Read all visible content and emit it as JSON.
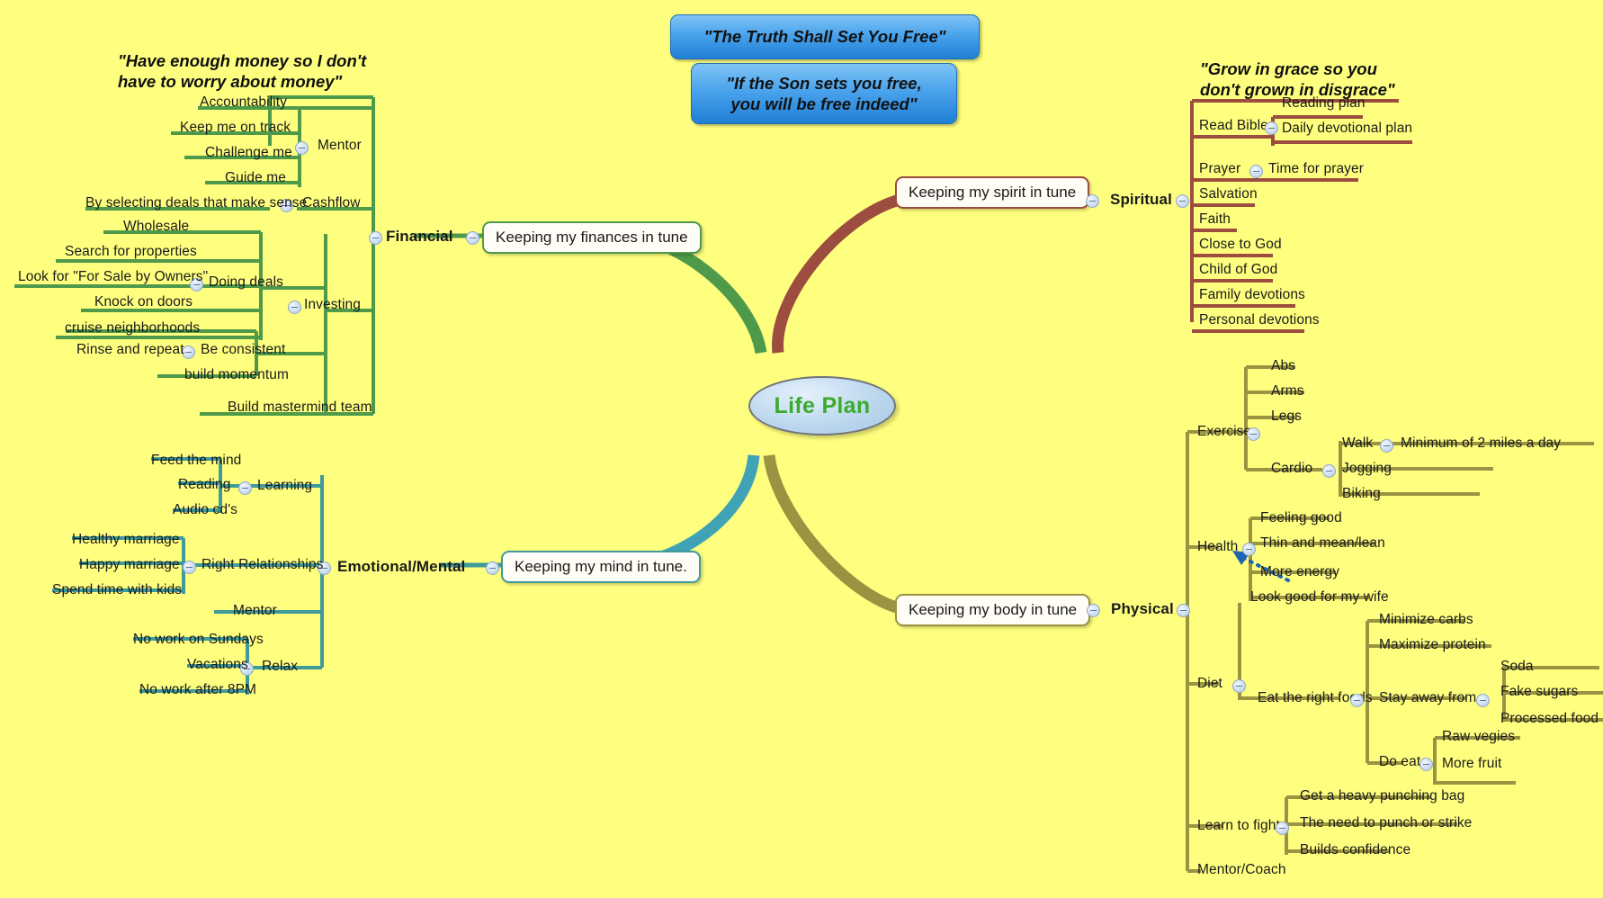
{
  "page": {
    "background_color": "#ffff7f",
    "root_label": "Life Plan",
    "root_text_color": "#3bab2e"
  },
  "scripture_boxes": [
    {
      "text": "\"The Truth Shall Set You Free\"",
      "color": "#2f8fdc"
    },
    {
      "text": "\"If the Son sets you free,\nyou will be free indeed\"",
      "color": "#2f8fdc"
    }
  ],
  "quotes": [
    {
      "id": "financial-quote",
      "text": "\"Have enough money so I don't\nhave to worry about money\""
    },
    {
      "id": "spiritual-quote",
      "text": "\"Grow in grace so you\ndon't grown in disgrace\""
    }
  ],
  "branches": {
    "financial": {
      "color": "#4f9a4a",
      "main_label": "Financial",
      "box_label": "Keeping my finances in tune",
      "nodes": {
        "mentor": "Mentor",
        "mentor_children": [
          "Accountability",
          "Keep me on track",
          "Challenge me",
          "Guide me"
        ],
        "cashflow": "Cashflow",
        "cashflow_children": [
          "By selecting deals that make sense"
        ],
        "investing": "Investing",
        "doing_deals": "Doing deals",
        "doing_deals_children": [
          "Wholesale",
          "Search for properties",
          "Look for \"For Sale by Owners\"",
          "Knock on doors",
          "cruise neighborhoods"
        ],
        "be_consistent": "Be consistent",
        "be_consistent_children": [
          "Rinse and repeat",
          "build momentum"
        ],
        "build_mastermind": "Build mastermind team"
      }
    },
    "spiritual": {
      "color": "#9c4d3f",
      "main_label": "Spiritual",
      "box_label": "Keeping my spirit in tune",
      "nodes": {
        "read_bible": "Read Bible",
        "read_bible_children": [
          "Reading plan",
          "Daily devotional plan"
        ],
        "prayer": "Prayer",
        "prayer_children": [
          "Time for prayer"
        ],
        "others": [
          "Salvation",
          "Faith",
          "Close to God",
          "Child of God",
          "Family devotions",
          "Personal devotions"
        ]
      }
    },
    "emotional": {
      "color": "#3f9a9a",
      "main_label": "Emotional/Mental",
      "box_label": "Keeping my mind in tune.",
      "nodes": {
        "learning": "Learning",
        "learning_children": [
          "Feed the mind",
          "Reading",
          "Audio cd's"
        ],
        "right_relationships": "Right Relationships",
        "right_relationships_children": [
          "Healthy marriage",
          "Happy marriage",
          "Spend time with kids"
        ],
        "mentor": "Mentor",
        "relax": "Relax",
        "relax_children": [
          "No work on Sundays",
          "Vacations",
          "No work after 8PM"
        ]
      }
    },
    "physical": {
      "color": "#9a9442",
      "main_label": "Physical",
      "box_label": "Keeping my body in tune",
      "nodes": {
        "exercise": "Exercise",
        "exercise_children": [
          "Abs",
          "Arms",
          "Legs"
        ],
        "cardio": "Cardio",
        "cardio_children": [
          "Walk",
          "Jogging",
          "Biking"
        ],
        "walk_child": "Minimum of 2 miles a day",
        "health": "Health",
        "health_children": [
          "Feeling good",
          "Thin and mean/lean",
          "More energy",
          "Look good for my wife"
        ],
        "diet": "Diet",
        "eat_right_foods": "Eat the right foods",
        "stay_away_from": "Stay away from",
        "stay_away_children": [
          "Minimize carbs",
          "Maximize protein"
        ],
        "stay_away_items": [
          "Soda",
          "Fake sugars",
          "Processed food"
        ],
        "do_eat": "Do eat",
        "do_eat_children": [
          "Raw vegies",
          "More fruit"
        ],
        "learn_to_fight": "Learn to fight",
        "learn_to_fight_children": [
          "Get a heavy punching bag",
          "The need to punch or strike",
          "Builds confidence"
        ],
        "mentor_coach": "Mentor/Coach"
      }
    }
  },
  "relationship_arrow": {
    "from": "Look good for my wife",
    "to": "Health",
    "color": "#1f63b5",
    "style": "dotted"
  }
}
